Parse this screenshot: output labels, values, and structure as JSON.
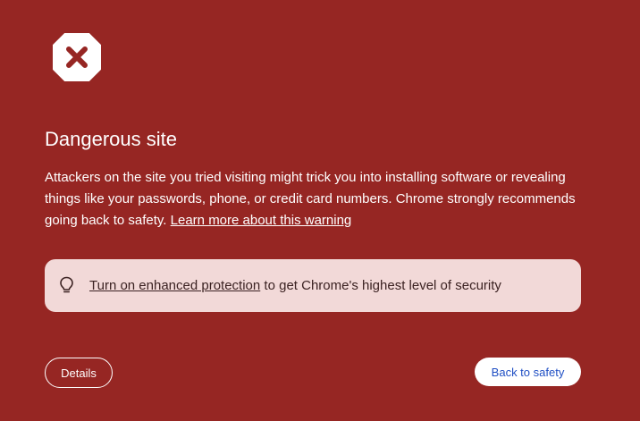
{
  "page": {
    "warning_icon": "stop-x-icon",
    "title": "Dangerous site",
    "message_text": "Attackers on the site you tried visiting might trick you into installing software or revealing things like your passwords, phone, or credit card numbers. Chrome strongly recommends going back to safety.",
    "learn_more_link": "Learn more about this warning"
  },
  "promo": {
    "icon": "lightbulb-icon",
    "link_text": "Turn on enhanced protection",
    "rest_text": "to get Chrome's highest level of security"
  },
  "buttons": {
    "details_label": "Details",
    "back_label": "Back to safety"
  },
  "colors": {
    "background": "#962623",
    "promo_background": "#f2d9d8",
    "primary_button_text": "#1f4fc4"
  }
}
